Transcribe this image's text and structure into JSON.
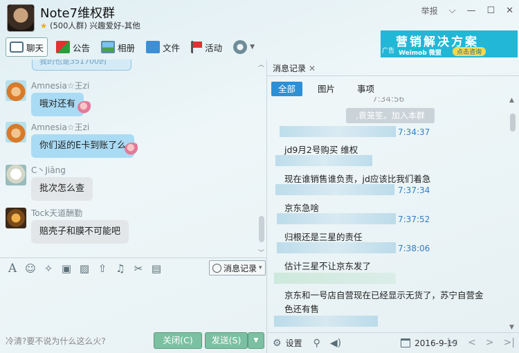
{
  "header": {
    "group_name": "Note7维权群",
    "group_info": "(500人群) 兴趣爱好-其他",
    "report": "举报"
  },
  "toolbar": {
    "items": [
      {
        "label": "聊天",
        "icon": "chat-icon"
      },
      {
        "label": "公告",
        "icon": "notice-icon"
      },
      {
        "label": "相册",
        "icon": "album-icon"
      },
      {
        "label": "文件",
        "icon": "folder-icon"
      },
      {
        "label": "活动",
        "icon": "flag-icon"
      }
    ]
  },
  "ad": {
    "title": "营销解决方案",
    "tag": "广告",
    "brand": "Weimob 微盟",
    "button": "点击咨询"
  },
  "chat": {
    "partial_text": "我的也是351700的",
    "messages": [
      {
        "nick": "Amnesia☆王zi",
        "text": "哦对还有"
      },
      {
        "nick": "Amnesia☆王zi",
        "text": "你们返的E卡到账了么"
      },
      {
        "nick": "C丶Jiāng",
        "text": "批次怎么查"
      },
      {
        "nick": "Tock天道酬勤",
        "text": "赔壳子和膜不可能吧"
      }
    ]
  },
  "input": {
    "history_label": "消息记录",
    "hint": "冷清?要不说为什么这么火?",
    "close_label": "关闭(C)",
    "send_label": "发送(S)"
  },
  "history_panel": {
    "tab_label": "消息记录",
    "filters": [
      "全部",
      "图片",
      "事项"
    ],
    "top_time": "7:34:56",
    "join_notice": ",袁笼笙。加入本群",
    "entries": [
      {
        "time": "7:34:37",
        "text": "jd9月2号购买    维权"
      },
      {
        "time": "",
        "text": "现在谁销售谁负责，jd应该比我们着急"
      },
      {
        "time": "7:37:34",
        "text": "京东急啥"
      },
      {
        "time": "7:37:52",
        "text": "归根还是三星的责任"
      },
      {
        "time": "7:38:06",
        "text": "估计三星不让京东发了"
      },
      {
        "time": "",
        "text": "京东和一号店自营现在已经显示无货了，苏宁自营金"
      },
      {
        "time": "",
        "text": "色还有售"
      }
    ],
    "settings_label": "设置",
    "date": "2016-9-19"
  }
}
